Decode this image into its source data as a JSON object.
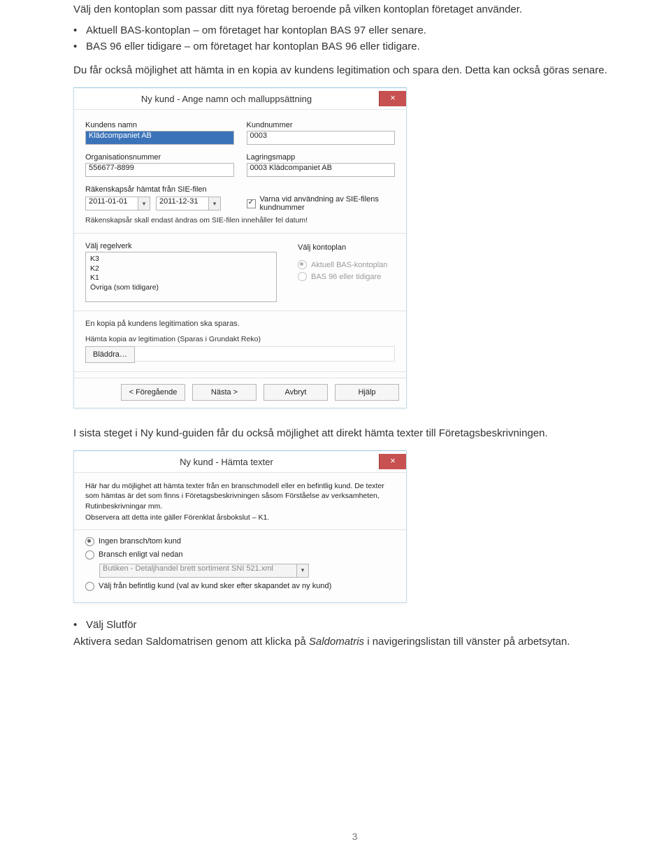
{
  "doc": {
    "intro": "Välj den kontoplan som passar ditt nya företag beroende på vilken kontoplan företaget använder.",
    "bullet1": "Aktuell BAS-kontoplan – om företaget har kontoplan BAS 97 eller senare.",
    "bullet2": "BAS 96 eller tidigare – om företaget har kontoplan BAS 96 eller tidigare.",
    "para2": "Du får också möjlighet att hämta in en kopia av kundens legitimation och spara den. Detta kan också göras senare.",
    "mid_para": "I sista steget i Ny kund-guiden får du också möjlighet att direkt hämta texter till Företagsbeskrivningen.",
    "bullet3": "Välj Slutför",
    "end_para_a": "Aktivera sedan Saldomatrisen genom att klicka på ",
    "end_para_b": "Saldomatris",
    "end_para_c": " i navigeringslistan till vänster på arbetsytan.",
    "page_number": "3"
  },
  "dlg1": {
    "title": "Ny kund - Ange namn och malluppsättning",
    "kundens_namn_label": "Kundens namn",
    "kundens_namn_value": "Klädcompaniet AB",
    "kundnummer_label": "Kundnummer",
    "kundnummer_value": "0003",
    "orgnr_label": "Organisationsnummer",
    "orgnr_value": "556677-8899",
    "lagringsmapp_label": "Lagringsmapp",
    "lagringsmapp_value": "0003 Klädcompaniet AB",
    "sie_label": "Räkenskapsår hämtat från SIE-filen",
    "date_from": "2011-01-01",
    "date_to": "2011-12-31",
    "warn_label": "Varna vid användning av SIE-filens kundnummer",
    "sie_note": "Räkenskapsår skall endast ändras om SIE-filen innehåller fel datum!",
    "regelverk_label": "Välj regelverk",
    "kontoplan_label": "Välj kontoplan",
    "regelverk_items": [
      "K3",
      "K2",
      "K1",
      "Övriga (som tidigare)"
    ],
    "radio_aktuell": "Aktuell BAS-kontoplan",
    "radio_bas96": "BAS 96 eller tidigare",
    "legit_header": "En kopia på kundens legitimation ska sparas.",
    "legit_sub": "Hämta kopia av legitimation (Sparas i Grundakt Reko)",
    "bladdra": "Bläddra…",
    "btn_prev": "< Föregående",
    "btn_next": "Nästa >",
    "btn_cancel": "Avbryt",
    "btn_help": "Hjälp"
  },
  "dlg2": {
    "title": "Ny kund - Hämta texter",
    "p1": "Här har du möjlighet att hämta texter från en branschmodell eller en befintlig kund. De texter som hämtas är det som finns i Företagsbeskrivningen såsom Förståelse av verksamheten, Rutinbeskrivningar mm.",
    "p2": "Observera att detta inte gäller Förenklat årsbokslut – K1.",
    "r1": "Ingen bransch/tom kund",
    "r2": "Bransch enligt val nedan",
    "dd": "Butiken - Detaljhandel brett sortiment SNI 521.xml",
    "r3": "Välj från befintlig kund (val av kund sker efter skapandet av ny kund)"
  }
}
